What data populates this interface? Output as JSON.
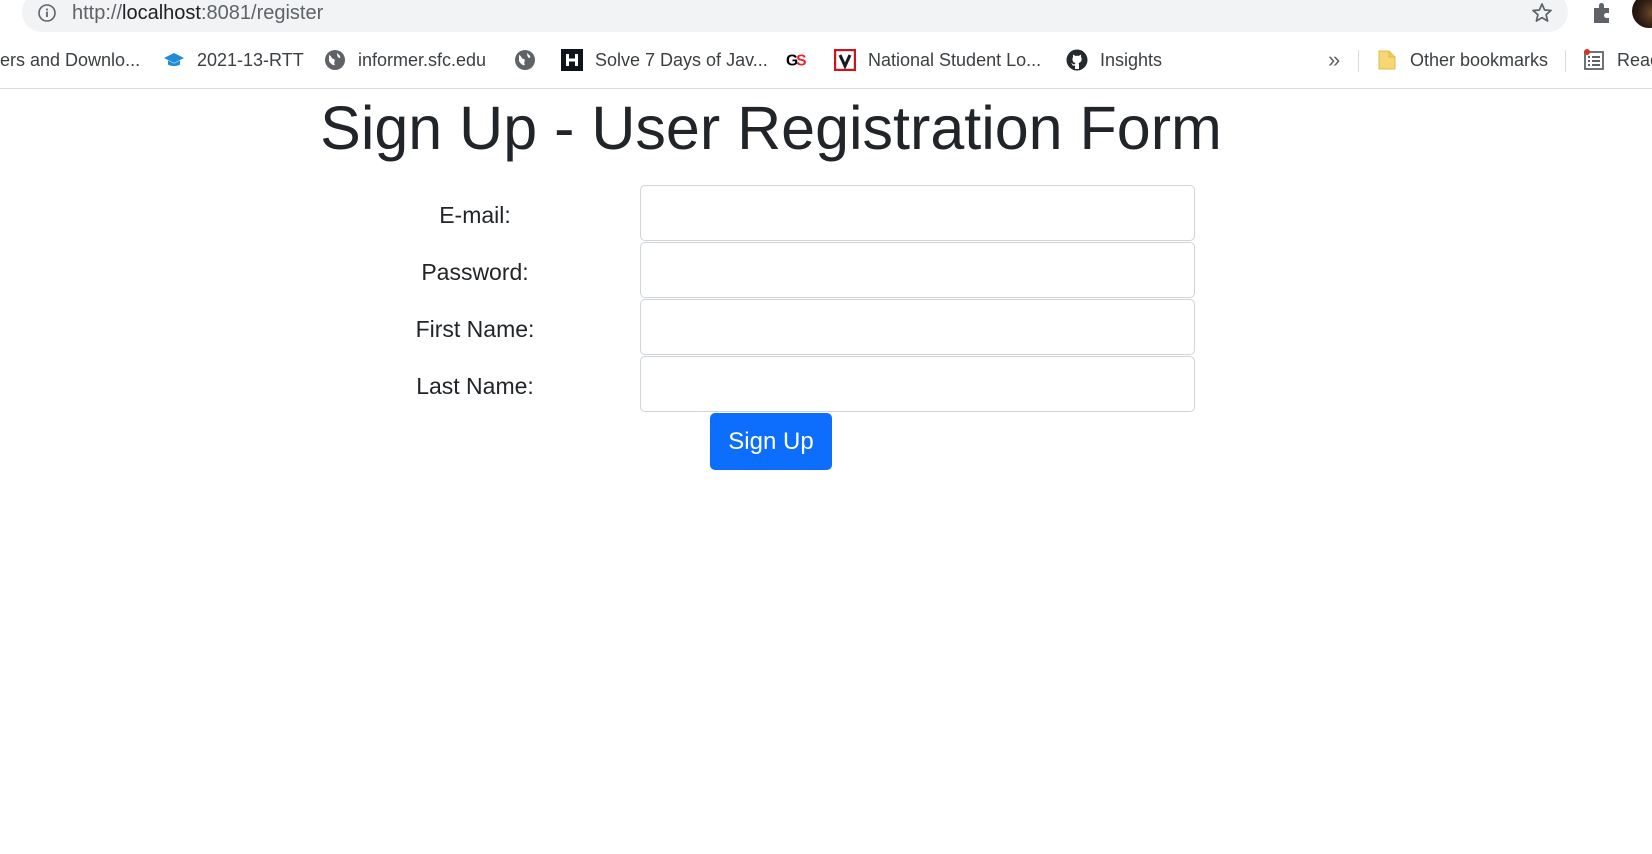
{
  "browser": {
    "url_prefix": "http://",
    "url_host": "localhost",
    "url_rest": ":8081/register",
    "bookmarks": [
      {
        "label": "ers and Downlo...",
        "icon": "none"
      },
      {
        "label": "2021-13-RTT",
        "icon": "graduation-cap-icon"
      },
      {
        "label": "informer.sfc.edu",
        "icon": "globe-icon"
      },
      {
        "label": "",
        "icon": "globe-icon"
      },
      {
        "label": "Solve 7 Days of Jav...",
        "icon": "hackerrank-icon"
      },
      {
        "label": "",
        "icon": "gs-icon"
      },
      {
        "label": "National Student Lo...",
        "icon": "v-icon"
      },
      {
        "label": "Insights",
        "icon": "github-icon"
      }
    ],
    "overflow_label": "»",
    "other_bookmarks_label": "Other bookmarks",
    "reading_list_label": "Reac"
  },
  "page": {
    "title": "Sign Up - User Registration Form",
    "form": {
      "email_label": "E-mail:",
      "email_value": "",
      "password_label": "Password:",
      "password_value": "",
      "first_name_label": "First Name:",
      "first_name_value": "",
      "last_name_label": "Last Name:",
      "last_name_value": "",
      "submit_label": "Sign Up"
    }
  },
  "colors": {
    "primary_button": "#0d6efd",
    "text": "#212529",
    "input_border": "#ced4da"
  }
}
